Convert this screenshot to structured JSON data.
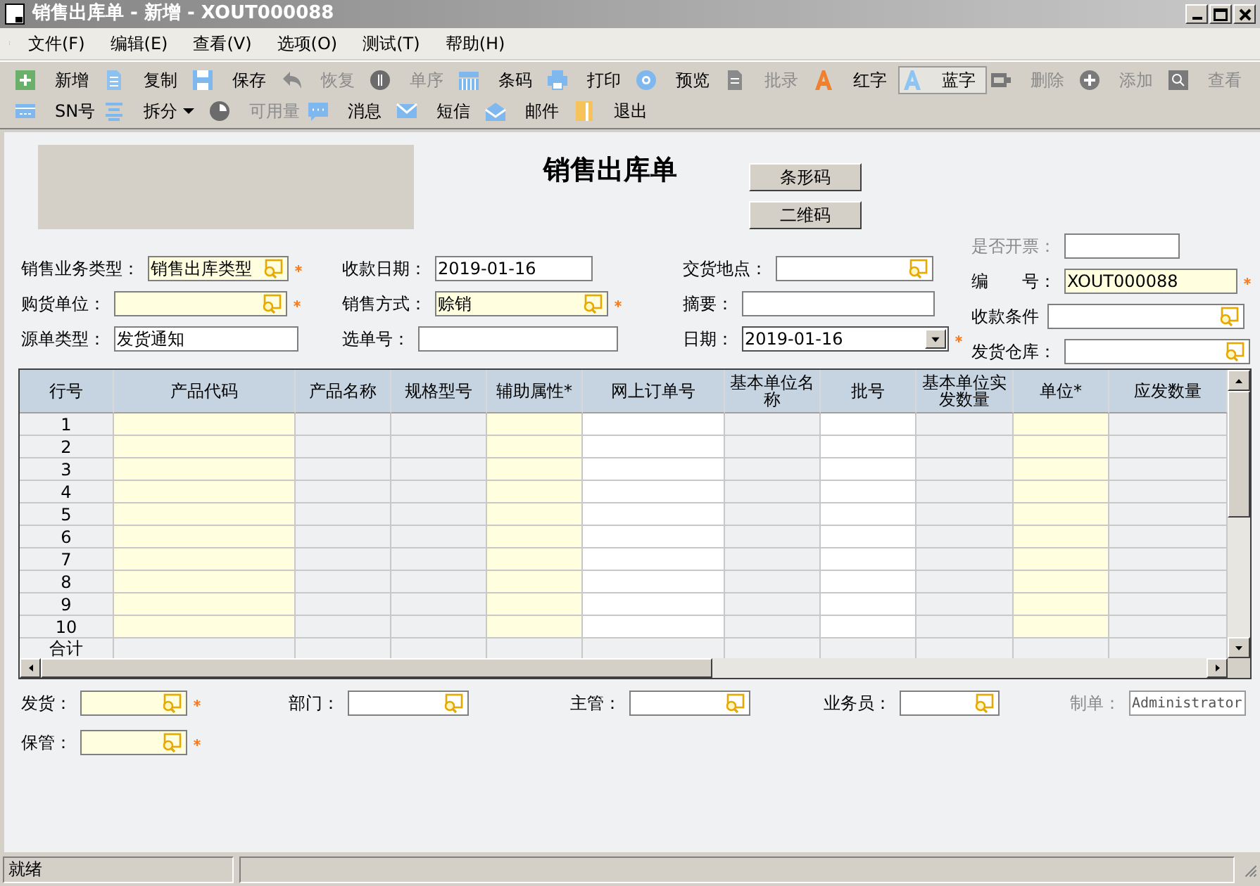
{
  "window": {
    "title": "销售出库单 - 新增 - XOUT000088"
  },
  "menu": [
    "文件(F)",
    "编辑(E)",
    "查看(V)",
    "选项(O)",
    "测试(T)",
    "帮助(H)"
  ],
  "toolbar_rows": [
    [
      {
        "label": "新增",
        "disabled": false,
        "selected": false
      },
      {
        "label": "复制",
        "disabled": false,
        "selected": false
      },
      {
        "label": "保存",
        "disabled": false,
        "selected": false
      },
      {
        "label": "恢复",
        "disabled": true,
        "selected": false
      },
      {
        "label": "单序",
        "disabled": true,
        "selected": false
      },
      {
        "label": "条码",
        "disabled": false,
        "selected": false
      },
      {
        "label": "打印",
        "disabled": false,
        "selected": false
      },
      {
        "label": "预览",
        "disabled": false,
        "selected": false
      },
      {
        "label": "批录",
        "disabled": true,
        "selected": false
      },
      {
        "label": "红字",
        "disabled": false,
        "selected": false
      },
      {
        "label": "蓝字",
        "disabled": false,
        "selected": true
      },
      {
        "label": "删除",
        "disabled": true,
        "selected": false
      },
      {
        "label": "添加",
        "disabled": true,
        "selected": false
      },
      {
        "label": "查看",
        "disabled": true,
        "selected": false
      }
    ],
    [
      {
        "label": "SN号",
        "disabled": false,
        "selected": false
      },
      {
        "label": "拆分",
        "disabled": false,
        "selected": false,
        "dropdown": true
      },
      {
        "label": "可用量",
        "disabled": true,
        "selected": false
      },
      {
        "label": "消息",
        "disabled": false,
        "selected": false
      },
      {
        "label": "短信",
        "disabled": false,
        "selected": false
      },
      {
        "label": "邮件",
        "disabled": false,
        "selected": false
      },
      {
        "label": "退出",
        "disabled": false,
        "selected": false
      }
    ]
  ],
  "form": {
    "title": "销售出库单",
    "buttons": [
      "条形码",
      "二维码"
    ],
    "header_columns": [
      [
        {
          "label": "销售业务类型：",
          "value": "销售出库类型",
          "kind": "lookup",
          "required": true,
          "highlighted": true,
          "dimmed": false
        },
        {
          "label": "购货单位：",
          "kind": "lookup",
          "required": true,
          "highlighted": true,
          "dimmed": false
        },
        {
          "label": "源单类型：",
          "value": "发货通知",
          "kind": "text",
          "required": false,
          "highlighted": false,
          "dimmed": false
        }
      ],
      [
        {
          "label": "收款日期：",
          "value": "2019-01-16",
          "kind": "text",
          "required": false,
          "highlighted": false,
          "dimmed": false
        },
        {
          "label": "销售方式：",
          "value": "赊销",
          "kind": "lookup",
          "required": true,
          "highlighted": true,
          "dimmed": false
        },
        {
          "label": "选单号：",
          "kind": "text",
          "required": false,
          "highlighted": false,
          "dimmed": false
        }
      ],
      [
        {
          "label": "交货地点：",
          "kind": "lookup",
          "required": false,
          "highlighted": false,
          "dimmed": false
        },
        {
          "label": "摘要：",
          "kind": "text",
          "required": false,
          "highlighted": false,
          "dimmed": false
        },
        {
          "label": "日期：",
          "value": "2019-01-16",
          "kind": "date",
          "required": true,
          "highlighted": false,
          "dimmed": false
        }
      ],
      [
        {
          "label": "是否开票：",
          "kind": "text",
          "required": false,
          "highlighted": false,
          "dimmed": true
        },
        {
          "label": "编　　号：",
          "value": "XOUT000088",
          "kind": "text",
          "required": true,
          "highlighted": true,
          "dimmed": false
        },
        {
          "label": "收款条件",
          "kind": "lookup",
          "required": false,
          "highlighted": false,
          "dimmed": false
        },
        {
          "label": "发货仓库：",
          "kind": "lookup",
          "required": false,
          "highlighted": false,
          "dimmed": false
        }
      ]
    ],
    "table": {
      "columns": [
        {
          "label": "行号",
          "kind": "index"
        },
        {
          "label": "产品代码",
          "kind": "required"
        },
        {
          "label": "产品名称",
          "kind": "readonly"
        },
        {
          "label": "规格型号",
          "kind": "readonly"
        },
        {
          "label": "辅助属性*",
          "kind": "required"
        },
        {
          "label": "网上订单号",
          "kind": "editable"
        },
        {
          "label": "基本单位名称",
          "kind": "readonly"
        },
        {
          "label": "批号",
          "kind": "editable"
        },
        {
          "label": "基本单位实发数量",
          "kind": "readonly"
        },
        {
          "label": "单位*",
          "kind": "required"
        },
        {
          "label": "应发数量",
          "kind": "readonly"
        }
      ],
      "rows": [
        "1",
        "2",
        "3",
        "4",
        "5",
        "6",
        "7",
        "8",
        "9",
        "10"
      ],
      "total_label": "合计"
    },
    "footer_rows": [
      [
        {
          "label": "发货：",
          "kind": "lookup",
          "required": true,
          "highlighted": true,
          "dimmed": false
        },
        {
          "label": "部门：",
          "kind": "lookup",
          "required": false,
          "highlighted": false,
          "dimmed": false
        },
        {
          "label": "主管：",
          "kind": "lookup",
          "required": false,
          "highlighted": false,
          "dimmed": false
        },
        {
          "label": "业务员：",
          "kind": "lookup",
          "required": false,
          "highlighted": false,
          "dimmed": false
        },
        {
          "label": "制单：",
          "value": "Administrator",
          "kind": "readonly",
          "required": false,
          "highlighted": false,
          "dimmed": true
        }
      ],
      [
        {
          "label": "保管：",
          "kind": "lookup",
          "required": true,
          "highlighted": true,
          "dimmed": false
        }
      ]
    ]
  },
  "status_bar": {
    "text": "就绪"
  }
}
